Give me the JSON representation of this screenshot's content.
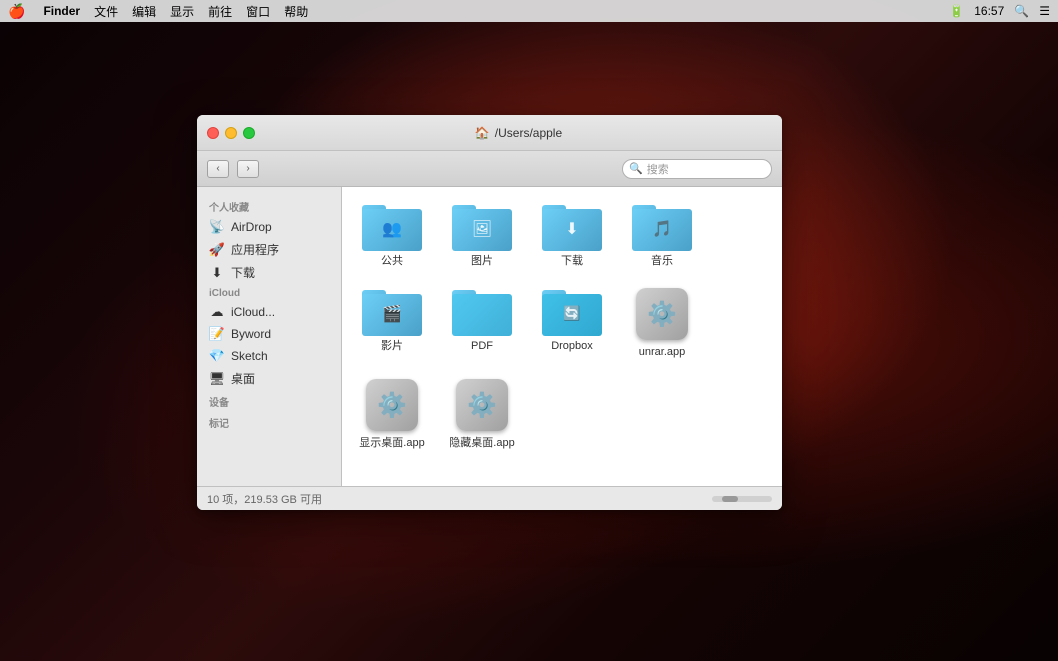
{
  "menubar": {
    "apple": "🍎",
    "app_name": "Finder",
    "menus": [
      "文件",
      "编辑",
      "显示",
      "前往",
      "窗口",
      "帮助"
    ],
    "right_items": [
      "16:57"
    ],
    "search_icon": "🔍"
  },
  "finder": {
    "title": "/Users/apple",
    "search_placeholder": "搜索",
    "nav_back": "‹",
    "nav_forward": "›",
    "sidebar": {
      "personal_label": "个人收藏",
      "items_personal": [
        {
          "id": "airdrop",
          "label": "AirDrop",
          "icon": "📡"
        },
        {
          "id": "applications",
          "label": "应用程序",
          "icon": "🚀"
        },
        {
          "id": "downloads",
          "label": "下载",
          "icon": "⬇"
        }
      ],
      "icloud_label": "iCloud",
      "items_icloud": [
        {
          "id": "icloud-drive",
          "label": "iCloud...",
          "icon": "☁"
        },
        {
          "id": "byword",
          "label": "Byword",
          "icon": "📝"
        },
        {
          "id": "sketch",
          "label": "Sketch",
          "icon": "💎"
        },
        {
          "id": "desktop",
          "label": "桌面",
          "icon": "🖥"
        }
      ],
      "devices_label": "设备",
      "tags_label": "标记"
    },
    "files": [
      {
        "id": "public",
        "label": "公共",
        "type": "folder",
        "variant": "public",
        "overlay": "👥"
      },
      {
        "id": "pictures",
        "label": "图片",
        "type": "folder",
        "variant": "pictures",
        "overlay": "🖼"
      },
      {
        "id": "downloads2",
        "label": "下载",
        "type": "folder",
        "variant": "downloads",
        "overlay": "⬇"
      },
      {
        "id": "music",
        "label": "音乐",
        "type": "folder",
        "variant": "music",
        "overlay": "🎵"
      },
      {
        "id": "movies",
        "label": "影片",
        "type": "folder",
        "variant": "movies",
        "overlay": "🎬"
      },
      {
        "id": "pdf",
        "label": "PDF",
        "type": "folder",
        "variant": "plain"
      },
      {
        "id": "dropbox",
        "label": "Dropbox",
        "type": "folder",
        "variant": "dropbox",
        "overlay": "🔄"
      },
      {
        "id": "unrar",
        "label": "unrar.app",
        "type": "app",
        "emoji": "⚙"
      },
      {
        "id": "show-desktop",
        "label": "显示桌面.app",
        "type": "app",
        "emoji": "⚙"
      },
      {
        "id": "hide-desktop",
        "label": "隐藏桌面.app",
        "type": "app",
        "emoji": "⚙"
      }
    ],
    "status": "10 项，219.53 GB 可用"
  }
}
